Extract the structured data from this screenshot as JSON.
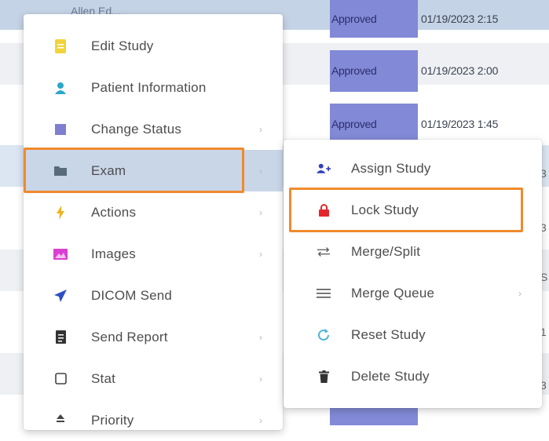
{
  "table": {
    "header_partial_text": "Allen Ed...",
    "rows": [
      {
        "status": "Approved",
        "date": "01/19/2023 2:15"
      },
      {
        "status": "Approved",
        "date": "01/19/2023 2:00"
      },
      {
        "status": "Approved",
        "date": "01/19/2023 1:45"
      }
    ],
    "edge_chars": [
      "3",
      "3",
      "S",
      "1",
      "3"
    ]
  },
  "context_menu": {
    "items": [
      {
        "label": "Edit Study",
        "icon": "document-icon",
        "has_submenu": false
      },
      {
        "label": "Patient Information",
        "icon": "person-icon",
        "has_submenu": false
      },
      {
        "label": "Change Status",
        "icon": "status-square-icon",
        "has_submenu": true
      },
      {
        "label": "Exam",
        "icon": "folder-icon",
        "has_submenu": true
      },
      {
        "label": "Actions",
        "icon": "lightning-icon",
        "has_submenu": true
      },
      {
        "label": "Images",
        "icon": "image-icon",
        "has_submenu": true
      },
      {
        "label": "DICOM Send",
        "icon": "send-icon",
        "has_submenu": false
      },
      {
        "label": "Send Report",
        "icon": "report-icon",
        "has_submenu": true
      },
      {
        "label": "Stat",
        "icon": "checkbox-icon",
        "has_submenu": true
      },
      {
        "label": "Priority",
        "icon": "priority-icon",
        "has_submenu": true
      }
    ]
  },
  "exam_submenu": {
    "items": [
      {
        "label": "Assign Study",
        "icon": "add-user-icon",
        "has_submenu": false
      },
      {
        "label": "Lock Study",
        "icon": "lock-icon",
        "has_submenu": false
      },
      {
        "label": "Merge/Split",
        "icon": "swap-arrows-icon",
        "has_submenu": false
      },
      {
        "label": "Merge Queue",
        "icon": "list-icon",
        "has_submenu": true
      },
      {
        "label": "Reset Study",
        "icon": "refresh-icon",
        "has_submenu": false
      },
      {
        "label": "Delete Study",
        "icon": "trash-icon",
        "has_submenu": false
      }
    ]
  },
  "colors": {
    "status_cell": "#8289d6",
    "highlight": "#f08a2c",
    "active_item": "#c9d6e8"
  }
}
